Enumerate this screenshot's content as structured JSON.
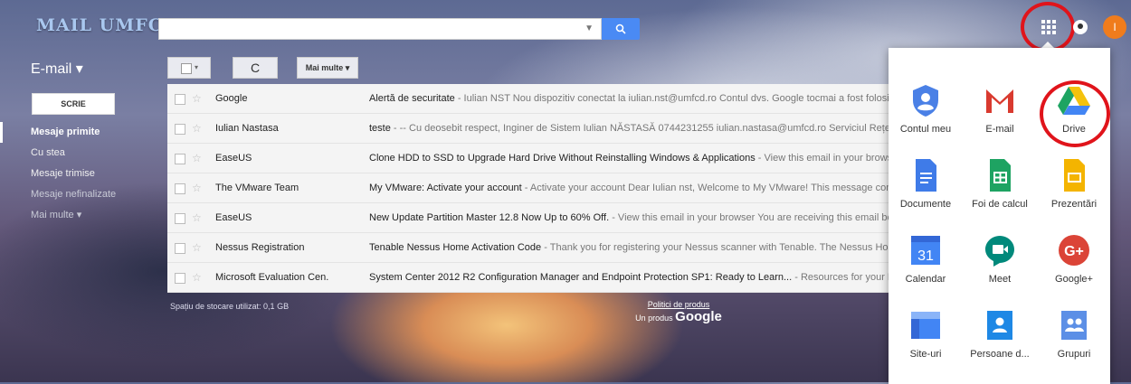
{
  "header": {
    "logo": "MAIL UMFCD",
    "avatar_letter": "I"
  },
  "sidebar": {
    "title": "E-mail ▾",
    "compose": "SCRIE",
    "items": [
      {
        "label": "Mesaje primite"
      },
      {
        "label": "Cu stea"
      },
      {
        "label": "Mesaje trimise"
      },
      {
        "label": "Mesaje nefinalizate"
      },
      {
        "label": "Mai multe ▾"
      }
    ]
  },
  "toolbar": {
    "refresh": "C",
    "more": "Mai multe ▾"
  },
  "emails": [
    {
      "sender": "Google",
      "subject": "Alertă de securitate",
      "preview": " - Iulian NST Nou dispozitiv conectat la iulian.nst@umfcd.ro Contul dvs. Google tocmai a fost folosit pen"
    },
    {
      "sender": "Iulian Nastasa",
      "subject": "teste",
      "preview": " - -- Cu deosebit respect, Inginer de Sistem Iulian NĂSTASĂ 0744231255 iulian.nastasa@umfcd.ro Serviciul Rețele și"
    },
    {
      "sender": "EaseUS",
      "subject": "Clone HDD to SSD to Upgrade Hard Drive Without Reinstalling Windows & Applications",
      "preview": " - View this email in your browser Y"
    },
    {
      "sender": "The VMware Team",
      "subject": "My VMware: Activate your account",
      "preview": " - Activate your account Dear Iulian nst, Welcome to My VMware! This message confirms"
    },
    {
      "sender": "EaseUS",
      "subject": "New Update Partition Master 12.8 Now Up to 60% Off.",
      "preview": " - View this email in your browser You are receiving this email becaus"
    },
    {
      "sender": "Nessus Registration",
      "subject": "Tenable Nessus Home Activation Code",
      "preview": " - Thank you for registering your Nessus scanner with Tenable. The Nessus Home s"
    },
    {
      "sender": "Microsoft Evaluation Cen.",
      "subject": "System Center 2012 R2 Configuration Manager and Endpoint Protection SP1: Ready to Learn...",
      "preview": " - Resources for your Micro"
    }
  ],
  "footer": {
    "storage": "Spațiu de stocare utilizat: 0,1 GB",
    "policy": "Politici de produs",
    "by": "Un produs ",
    "google": "Google"
  },
  "apps": [
    {
      "label": "Contul meu",
      "icon": "account-icon"
    },
    {
      "label": "E-mail",
      "icon": "gmail-icon"
    },
    {
      "label": "Drive",
      "icon": "drive-icon"
    },
    {
      "label": "Documente",
      "icon": "docs-icon"
    },
    {
      "label": "Foi de calcul",
      "icon": "sheets-icon"
    },
    {
      "label": "Prezentări",
      "icon": "slides-icon"
    },
    {
      "label": "Calendar",
      "icon": "calendar-icon",
      "text": "31"
    },
    {
      "label": "Meet",
      "icon": "meet-icon"
    },
    {
      "label": "Google+",
      "icon": "google-plus-icon",
      "text": "G+"
    },
    {
      "label": "Site-uri",
      "icon": "sites-icon"
    },
    {
      "label": "Persoane d...",
      "icon": "contacts-icon"
    },
    {
      "label": "Grupuri",
      "icon": "groups-icon"
    }
  ],
  "colors": {
    "accent": "#4a8af4",
    "highlight_circle": "#e0141b",
    "avatar": "#f07c1c"
  }
}
